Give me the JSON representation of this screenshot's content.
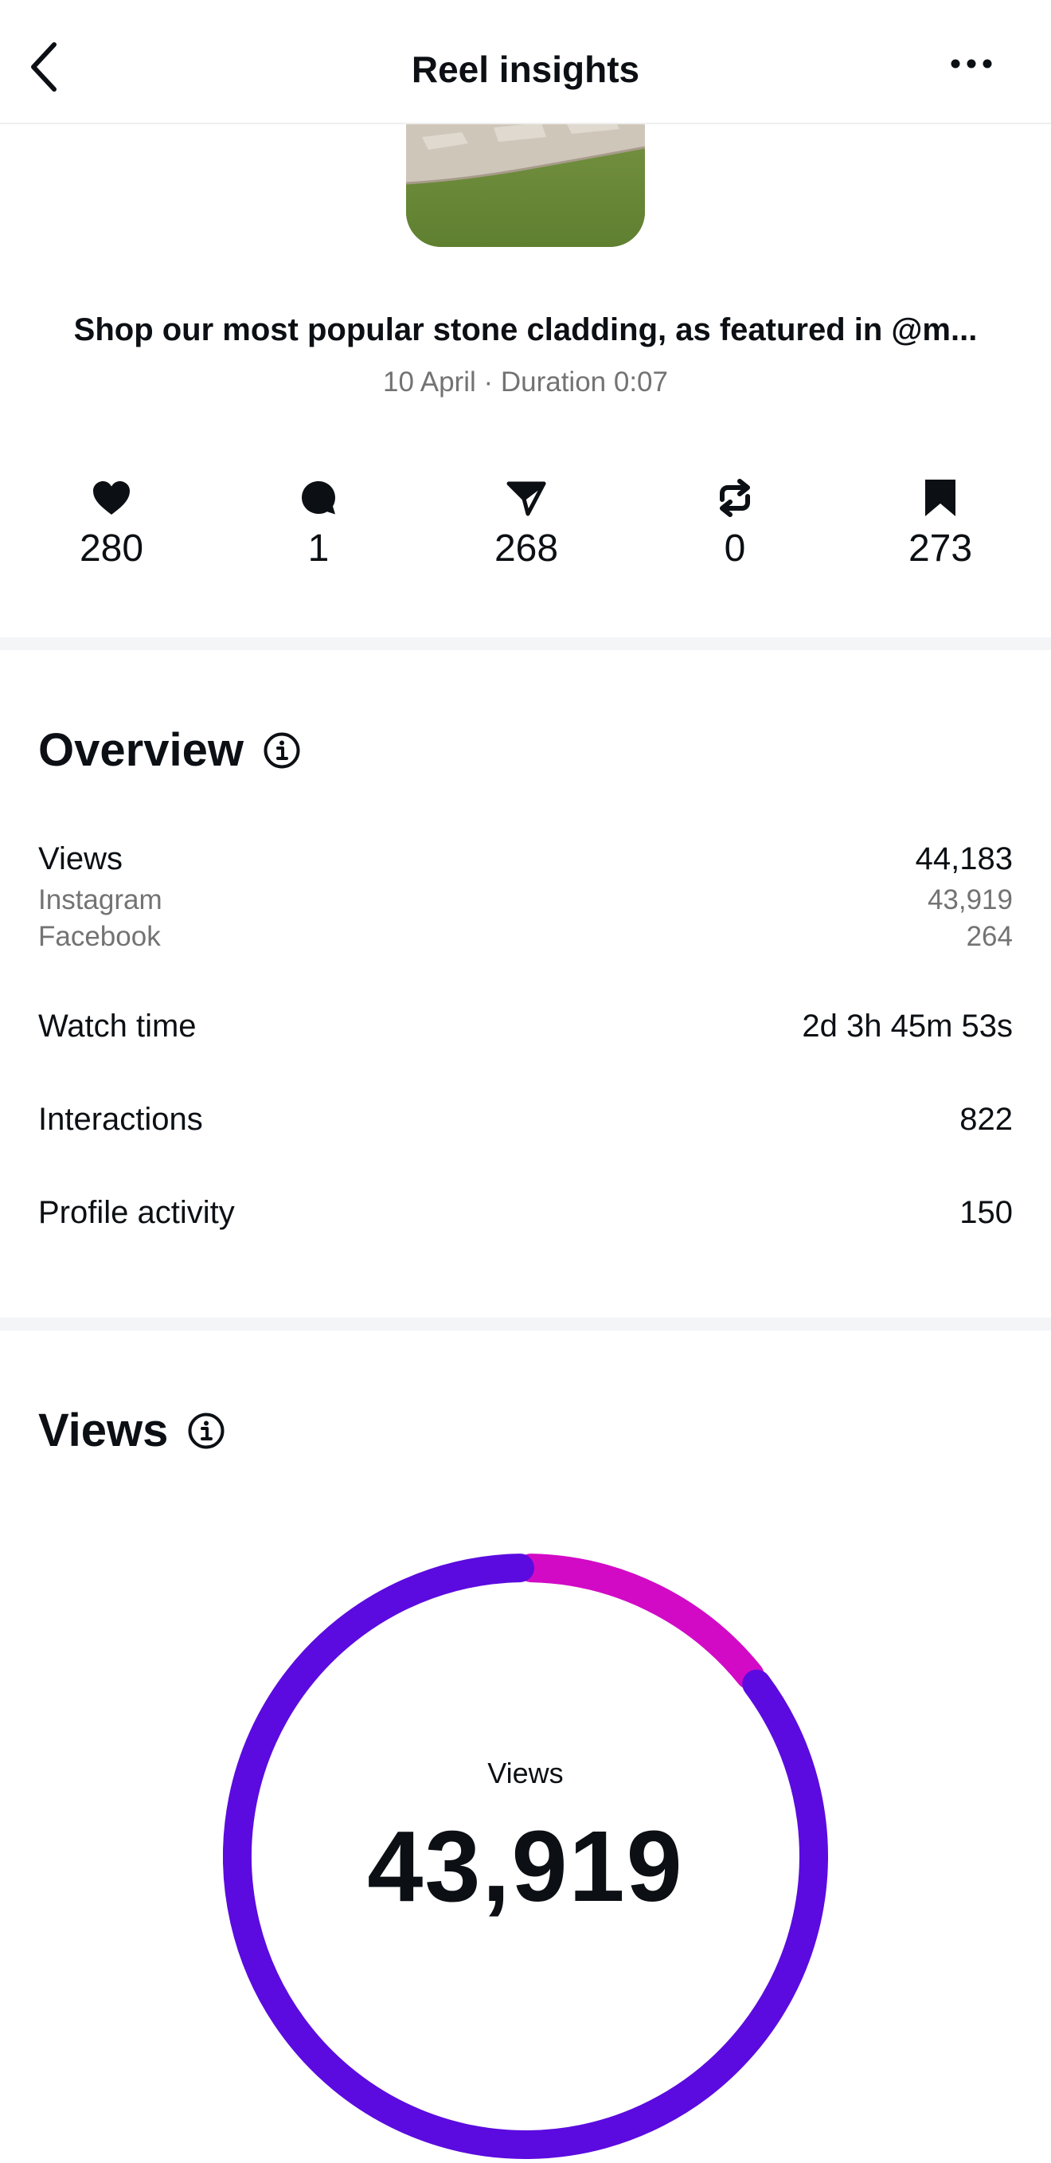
{
  "header": {
    "title": "Reel insights"
  },
  "reel": {
    "caption": "Shop our most popular stone cladding, as featured in @m...",
    "meta": "10 April · Duration 0:07"
  },
  "stats": [
    {
      "icon": "heart-icon",
      "value": "280"
    },
    {
      "icon": "comment-icon",
      "value": "1"
    },
    {
      "icon": "share-icon",
      "value": "268"
    },
    {
      "icon": "repost-icon",
      "value": "0"
    },
    {
      "icon": "bookmark-icon",
      "value": "273"
    }
  ],
  "overview": {
    "title": "Overview",
    "rows": {
      "views": {
        "label": "Views",
        "value": "44,183"
      },
      "instagram": {
        "label": "Instagram",
        "value": "43,919"
      },
      "facebook": {
        "label": "Facebook",
        "value": "264"
      },
      "watch_time": {
        "label": "Watch time",
        "value": "2d 3h 45m 53s"
      },
      "interactions": {
        "label": "Interactions",
        "value": "822"
      },
      "profile_activity": {
        "label": "Profile activity",
        "value": "150"
      }
    }
  },
  "views_section": {
    "title": "Views",
    "center_label": "Views",
    "center_value": "43,919"
  },
  "chart_data": {
    "type": "pie",
    "title": "",
    "total": 43919,
    "segments": [
      {
        "value": 0.145,
        "color": "#d20ac6"
      },
      {
        "value": 0.855,
        "color": "#5b0bdf"
      }
    ]
  },
  "colors": {
    "text": "#0c1014",
    "secondary": "#737373",
    "divider": "#f3f5f7",
    "donut_primary": "#5b0bdf",
    "donut_accent": "#d20ac6"
  }
}
